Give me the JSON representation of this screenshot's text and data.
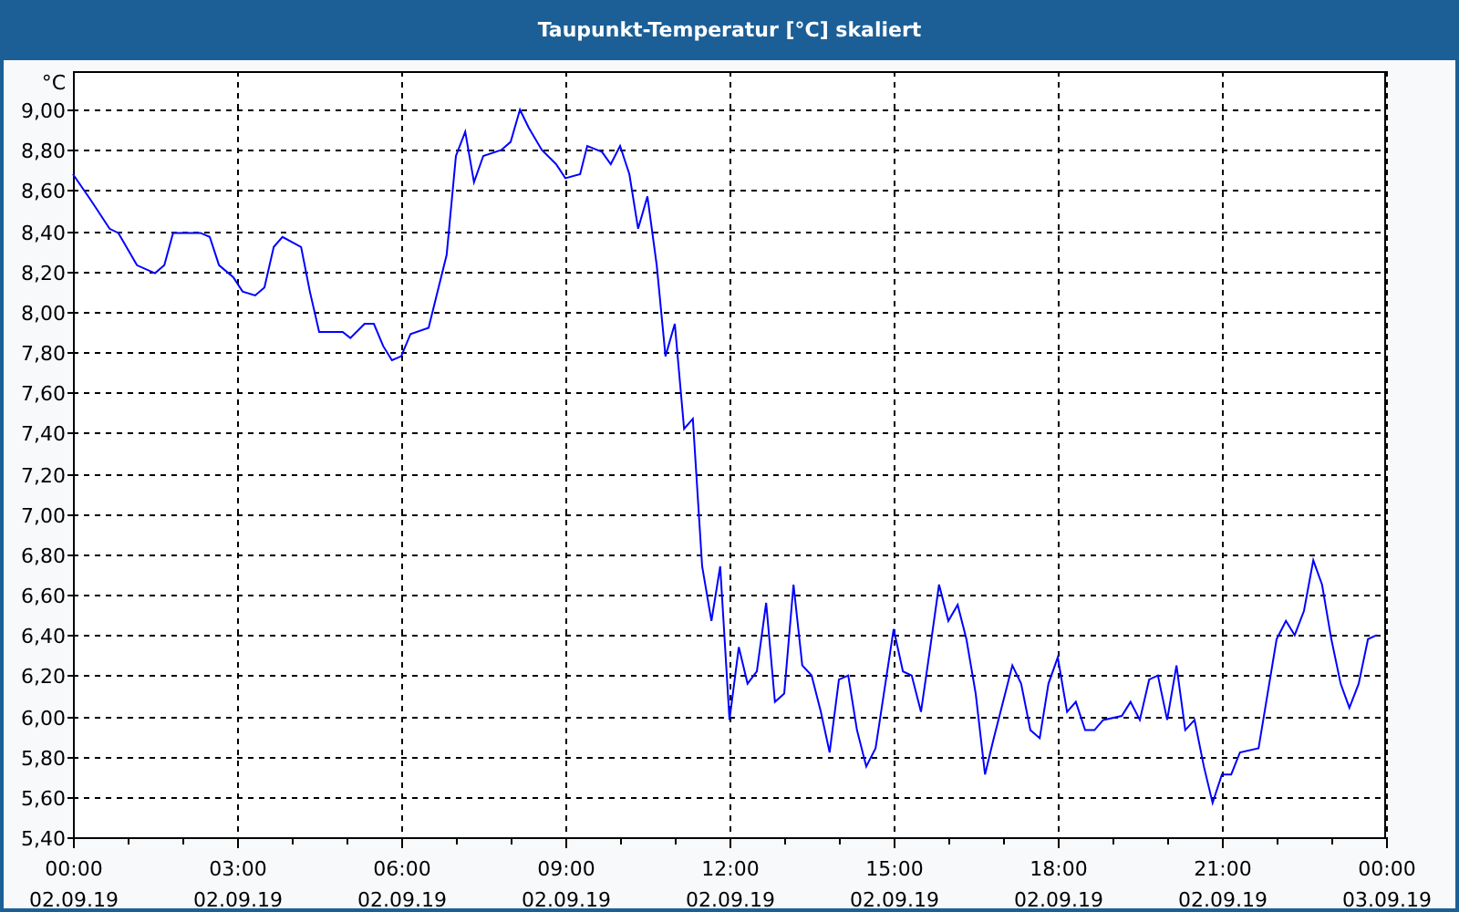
{
  "window": {
    "title": "Taupunkt-Temperatur [°C] skaliert"
  },
  "chart": {
    "chart_data": {
      "type": "line",
      "ylabel": "°C",
      "xlim": [
        0,
        24
      ],
      "ylim": [
        5.4,
        9.19
      ],
      "yticks": [
        {
          "value": 5.4,
          "label": "5,40"
        },
        {
          "value": 5.6,
          "label": "5,60"
        },
        {
          "value": 5.8,
          "label": "5,80"
        },
        {
          "value": 6.0,
          "label": "6,00"
        },
        {
          "value": 6.2,
          "label": "6,20"
        },
        {
          "value": 6.4,
          "label": "6,40"
        },
        {
          "value": 6.6,
          "label": "6,60"
        },
        {
          "value": 6.8,
          "label": "6,80"
        },
        {
          "value": 7.0,
          "label": "7,00"
        },
        {
          "value": 7.2,
          "label": "7,20"
        },
        {
          "value": 7.4,
          "label": "7,40"
        },
        {
          "value": 7.6,
          "label": "7,60"
        },
        {
          "value": 7.8,
          "label": "7,80"
        },
        {
          "value": 8.0,
          "label": "8,00"
        },
        {
          "value": 8.2,
          "label": "8,20"
        },
        {
          "value": 8.4,
          "label": "8,40"
        },
        {
          "value": 8.6,
          "label": "8,60"
        },
        {
          "value": 8.8,
          "label": "8,80"
        },
        {
          "value": 9.0,
          "label": "9,00"
        }
      ],
      "xticks": [
        {
          "value": 0,
          "label": "00:00"
        },
        {
          "value": 3,
          "label": "03:00"
        },
        {
          "value": 6,
          "label": "06:00"
        },
        {
          "value": 9,
          "label": "09:00"
        },
        {
          "value": 12,
          "label": "12:00"
        },
        {
          "value": 15,
          "label": "15:00"
        },
        {
          "value": 18,
          "label": "18:00"
        },
        {
          "value": 21,
          "label": "21:00"
        },
        {
          "value": 24,
          "label": "00:00"
        }
      ],
      "x": [
        0,
        0.33,
        0.67,
        0.83,
        1.17,
        1.5,
        1.67,
        1.83,
        2.33,
        2.5,
        2.67,
        2.93,
        3.1,
        3.33,
        3.5,
        3.67,
        3.83,
        4.17,
        4.33,
        4.5,
        4.93,
        5.07,
        5.33,
        5.5,
        5.67,
        5.83,
        6,
        6.17,
        6.5,
        6.83,
        7,
        7.17,
        7.33,
        7.5,
        7.83,
        8,
        8.17,
        8.33,
        8.57,
        8.83,
        9,
        9.27,
        9.4,
        9.67,
        9.83,
        10,
        10.17,
        10.33,
        10.5,
        10.67,
        10.83,
        11,
        11.17,
        11.33,
        11.5,
        11.67,
        11.83,
        12,
        12.17,
        12.33,
        12.5,
        12.67,
        12.83,
        13,
        13.17,
        13.33,
        13.5,
        13.67,
        13.83,
        14,
        14.17,
        14.33,
        14.5,
        14.67,
        15,
        15.17,
        15.33,
        15.5,
        15.67,
        15.83,
        16,
        16.17,
        16.33,
        16.5,
        16.67,
        16.83,
        17,
        17.17,
        17.33,
        17.5,
        17.67,
        17.83,
        18,
        18.17,
        18.33,
        18.5,
        18.67,
        18.83,
        19.17,
        19.33,
        19.5,
        19.67,
        19.83,
        20,
        20.17,
        20.33,
        20.5,
        20.67,
        20.83,
        21,
        21.17,
        21.33,
        21.67,
        22,
        22.17,
        22.33,
        22.5,
        22.67,
        22.83,
        23,
        23.17,
        23.33,
        23.5,
        23.67,
        23.83
      ],
      "grid": true,
      "series": [
        {
          "color": "#0000ff",
          "values": [
            8.68,
            8.55,
            8.41,
            8.39,
            8.23,
            8.19,
            8.23,
            8.39,
            8.39,
            8.37,
            8.23,
            8.17,
            8.1,
            8.08,
            8.12,
            8.32,
            8.37,
            8.32,
            8.1,
            7.9,
            7.9,
            7.87,
            7.94,
            7.94,
            7.83,
            7.76,
            7.78,
            7.89,
            7.92,
            8.28,
            8.77,
            8.89,
            8.64,
            8.77,
            8.8,
            8.84,
            9.0,
            8.91,
            8.8,
            8.73,
            8.66,
            8.68,
            8.82,
            8.79,
            8.73,
            8.82,
            8.68,
            8.41,
            8.57,
            8.23,
            7.78,
            7.94,
            7.42,
            7.47,
            6.74,
            6.47,
            6.74,
            5.98,
            6.34,
            6.16,
            6.22,
            6.56,
            6.07,
            6.11,
            6.65,
            6.25,
            6.2,
            6.02,
            5.82,
            6.18,
            6.2,
            5.93,
            5.75,
            5.84,
            6.43,
            6.22,
            6.2,
            6.02,
            6.34,
            6.65,
            6.47,
            6.55,
            6.38,
            6.11,
            5.71,
            5.89,
            6.07,
            6.25,
            6.16,
            5.93,
            5.89,
            6.16,
            6.29,
            6.02,
            6.07,
            5.93,
            5.93,
            5.98,
            6.0,
            6.07,
            5.98,
            6.18,
            6.2,
            5.98,
            6.25,
            5.93,
            5.98,
            5.75,
            5.57,
            5.71,
            5.71,
            5.82,
            5.84,
            6.38,
            6.47,
            6.4,
            6.52,
            6.77,
            6.65,
            6.38,
            6.16,
            6.04,
            6.16,
            6.38,
            6.4
          ]
        }
      ]
    },
    "date_labels": [
      "02.09.19",
      "02.09.19",
      "02.09.19",
      "02.09.19",
      "02.09.19",
      "02.09.19",
      "02.09.19",
      "02.09.19",
      "03.09.19"
    ]
  }
}
